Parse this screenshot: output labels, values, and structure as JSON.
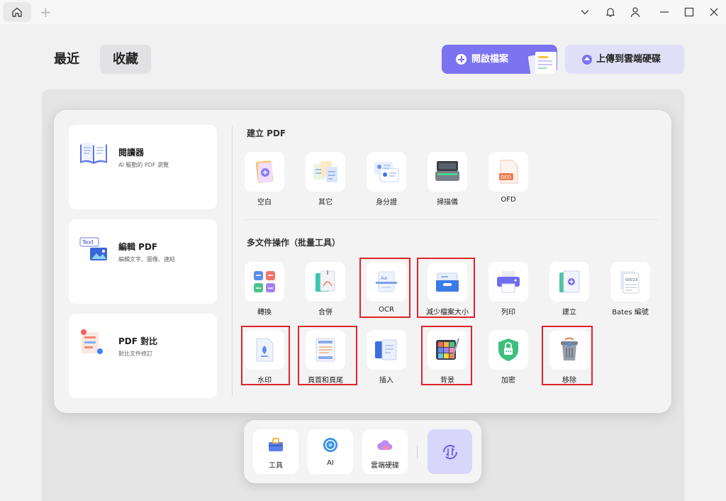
{
  "titlebar": {
    "home_tab": "home-icon",
    "new_tab": "+"
  },
  "header": {
    "tab_recent": "最近",
    "tab_favorites": "收藏",
    "open_file": "開啟檔案",
    "upload_cloud": "上傳到雲端硬碟"
  },
  "panel": {
    "cards": [
      {
        "title": "閱讀器",
        "subtitle": "AI 驅動的 PDF 瀏覽"
      },
      {
        "title": "編輯 PDF",
        "subtitle": "編輯文字、圖像、連結"
      },
      {
        "title": "PDF 對比",
        "subtitle": "對比文件修訂"
      }
    ],
    "create_section": {
      "title": "建立 PDF",
      "items": [
        "空白",
        "其它",
        "身分證",
        "掃描儀",
        "OFD"
      ]
    },
    "batch_section": {
      "title": "多文件操作（批量工具）",
      "items": [
        "轉換",
        "合併",
        "OCR",
        "減少檔案大小",
        "列印",
        "建立",
        "Bates 編號",
        "水印",
        "頁首和頁尾",
        "插入",
        "背景",
        "加密",
        "移除"
      ]
    }
  },
  "dock": {
    "items": [
      "工具",
      "AI",
      "雲端硬碟"
    ]
  },
  "colors": {
    "accent": "#7b73f1",
    "highlight": "#e0242c"
  }
}
